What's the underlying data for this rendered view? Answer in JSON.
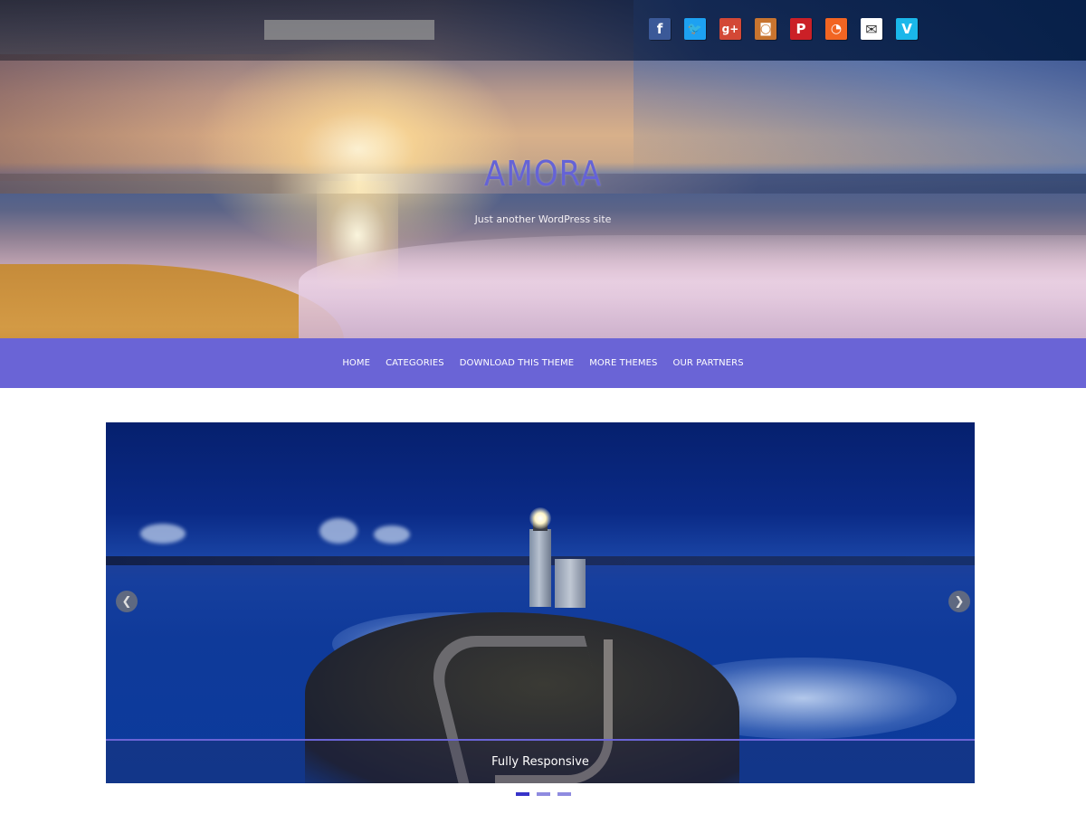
{
  "header": {
    "search": {
      "placeholder": "",
      "value": ""
    },
    "social": [
      {
        "name": "facebook",
        "glyph": "f",
        "color": "#3b5998",
        "icon": "facebook-icon"
      },
      {
        "name": "twitter",
        "glyph": "🐦",
        "color": "#1da1f2",
        "icon": "twitter-icon"
      },
      {
        "name": "google-plus",
        "glyph": "g+",
        "color": "#d34836",
        "icon": "google-plus-icon"
      },
      {
        "name": "instagram",
        "glyph": "◙",
        "color": "#c8742f",
        "icon": "instagram-icon"
      },
      {
        "name": "pinterest",
        "glyph": "P",
        "color": "#cb2027",
        "icon": "pinterest-icon"
      },
      {
        "name": "rss",
        "glyph": "◔",
        "color": "#f26522",
        "icon": "rss-icon"
      },
      {
        "name": "email",
        "glyph": "✉",
        "color": "#ffffff",
        "icon": "email-icon"
      },
      {
        "name": "vimeo",
        "glyph": "V",
        "color": "#1ab7ea",
        "icon": "vimeo-icon"
      }
    ],
    "site_title": "AMORA",
    "tagline": "Just another WordPress site"
  },
  "nav": {
    "items": [
      {
        "label": "HOME"
      },
      {
        "label": "CATEGORIES"
      },
      {
        "label": "DOWNLOAD THIS THEME"
      },
      {
        "label": "MORE THEMES"
      },
      {
        "label": "OUR PARTNERS"
      }
    ],
    "background": "#6a64d6"
  },
  "slider": {
    "caption": "Fully Responsive",
    "prev_glyph": "❮",
    "next_glyph": "❯",
    "dots": [
      {
        "active": true
      },
      {
        "active": false
      },
      {
        "active": false
      }
    ]
  },
  "colors": {
    "accent": "#6a64d6",
    "title": "#6563d6",
    "dot_active": "#3733c9"
  }
}
